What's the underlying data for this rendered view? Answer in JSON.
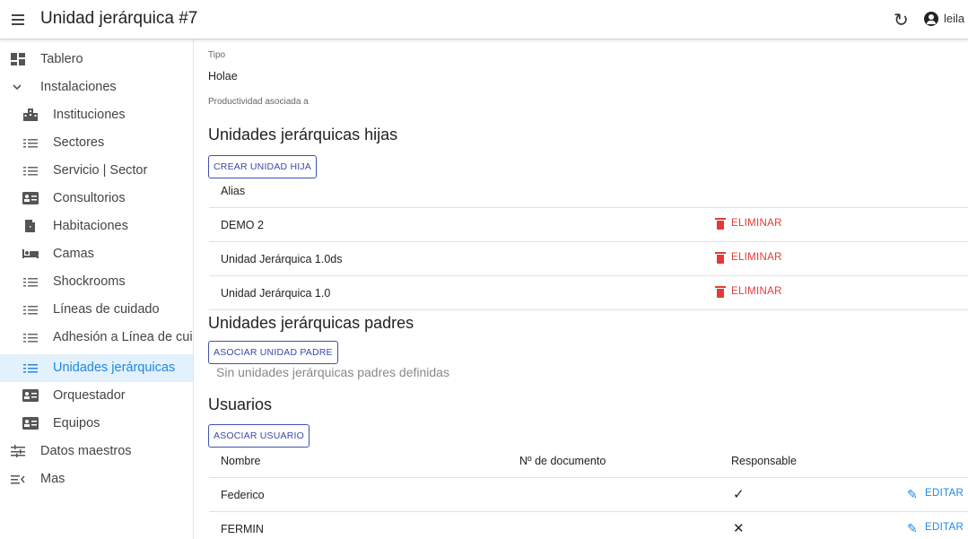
{
  "header": {
    "title": "Unidad jerárquica #7",
    "refresh_icon": "↻",
    "user_name": "leila"
  },
  "sidebar": {
    "items": [
      {
        "label": "Tablero",
        "icon": "dashboard-icon"
      },
      {
        "label": "Instalaciones",
        "icon": "chevron-down-icon"
      },
      {
        "label": "Instituciones",
        "icon": "city-icon"
      },
      {
        "label": "Sectores",
        "icon": "list-icon"
      },
      {
        "label": "Servicio | Sector",
        "icon": "list-icon"
      },
      {
        "label": "Consultorios",
        "icon": "id-card-icon"
      },
      {
        "label": "Habitaciones",
        "icon": "door-icon"
      },
      {
        "label": "Camas",
        "icon": "bed-icon"
      },
      {
        "label": "Shockrooms",
        "icon": "list-icon"
      },
      {
        "label": "Líneas de cuidado",
        "icon": "list-icon"
      },
      {
        "label": "Adhesión a Línea de cuidado",
        "icon": "list-icon"
      },
      {
        "label": "Unidades jerárquicas",
        "icon": "list-icon",
        "active": true
      },
      {
        "label": "Orquestador",
        "icon": "id-card-icon"
      },
      {
        "label": "Equipos",
        "icon": "id-card-icon"
      },
      {
        "label": "Datos maestros",
        "icon": "tune-icon"
      },
      {
        "label": "Mas",
        "icon": "menu-open-icon"
      }
    ],
    "active_color": "#1e88e5"
  },
  "main": {
    "tipo_label": "Tipo",
    "tipo_value": "Holae",
    "productividad_label": "Productividad asociada a",
    "hijas": {
      "title": "Unidades jerárquicas hijas",
      "button": "CREAR UNIDAD HIJA",
      "column": "Alias",
      "rows": [
        {
          "alias": "DEMO 2",
          "action": "ELIMINAR"
        },
        {
          "alias": "Unidad Jerárquica 1.0ds",
          "action": "ELIMINAR"
        },
        {
          "alias": "Unidad Jerárquica 1.0",
          "action": "ELIMINAR"
        }
      ]
    },
    "padres": {
      "title": "Unidades jerárquicas padres",
      "button": "ASOCIAR UNIDAD PADRE",
      "empty": "Sin unidades jerárquicas padres definidas"
    },
    "usuarios": {
      "title": "Usuarios",
      "button": "ASOCIAR USUARIO",
      "columns": {
        "nombre": "Nombre",
        "documento": "Nº de documento",
        "responsable": "Responsable"
      },
      "rows": [
        {
          "nombre": "Federico",
          "documento": "",
          "responsable": "✓",
          "action": "EDITAR"
        },
        {
          "nombre": "FERMIN",
          "documento": "",
          "responsable": "✕",
          "action": "EDITAR"
        }
      ]
    }
  },
  "colors": {
    "primary": "#3949ab",
    "danger": "#e53935",
    "link": "#1e88e5"
  }
}
